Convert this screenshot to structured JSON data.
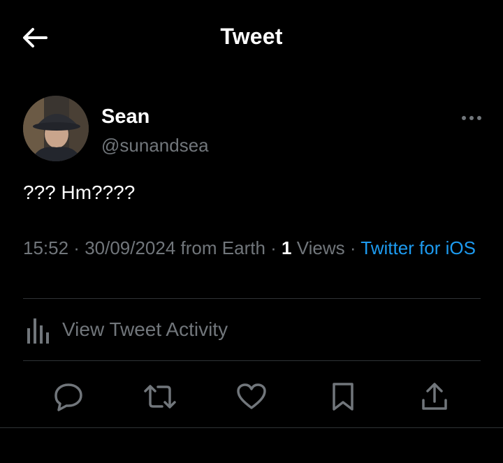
{
  "header": {
    "title": "Tweet",
    "back_icon": "arrow-left-icon"
  },
  "author": {
    "name": "Sean",
    "handle": "@sunandsea",
    "avatar_icon": "profile-photo",
    "more_icon": "more-horizontal-icon"
  },
  "tweet": {
    "text": "??? Hm????"
  },
  "meta": {
    "time": "15:52",
    "separator": " · ",
    "date": "30/09/2024",
    "location": " from Earth",
    "view_count": "1",
    "views_label": " Views",
    "source": "Twitter for iOS"
  },
  "activity": {
    "label": "View Tweet Activity",
    "icon": "bar-chart-icon"
  },
  "actions": {
    "reply_icon": "reply-icon",
    "retweet_icon": "retweet-icon",
    "like_icon": "heart-icon",
    "bookmark_icon": "bookmark-icon",
    "share_icon": "share-icon"
  },
  "colors": {
    "background": "#000000",
    "primary_text": "#ffffff",
    "secondary_text": "#71767b",
    "accent": "#1d9bf0",
    "divider": "#2f3336"
  }
}
